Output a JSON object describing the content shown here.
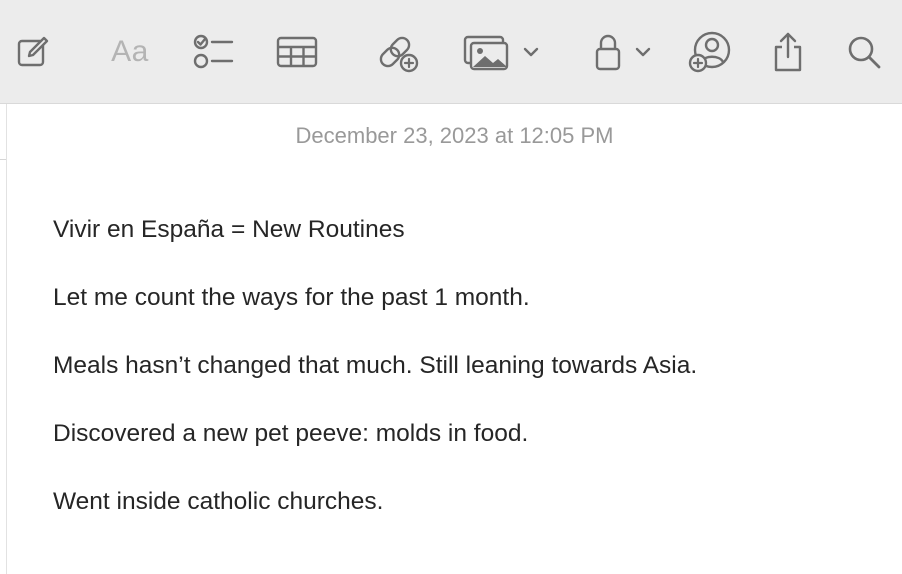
{
  "toolbar": {
    "items": [
      {
        "name": "compose-icon",
        "label": "New Note"
      },
      {
        "name": "format-aa",
        "label": "Aa"
      },
      {
        "name": "checklist-icon",
        "label": "Checklist"
      },
      {
        "name": "table-icon",
        "label": "Table"
      },
      {
        "name": "add-link-icon",
        "label": "Add Link"
      },
      {
        "name": "media-icon",
        "label": "Media"
      },
      {
        "name": "lock-icon",
        "label": "Lock"
      },
      {
        "name": "collaborate-icon",
        "label": "Collaborate"
      },
      {
        "name": "share-icon",
        "label": "Share"
      },
      {
        "name": "search-icon",
        "label": "Search"
      }
    ],
    "format_label": "Aa"
  },
  "note": {
    "timestamp": "December 23, 2023 at 12:05 PM",
    "lines": [
      "Vivir en España = New Routines",
      "Let me count the ways for the past 1 month.",
      "Meals hasn’t changed that much. Still leaning towards Asia.",
      "Discovered a new pet peeve: molds in food.",
      "Went inside catholic churches."
    ]
  },
  "colors": {
    "toolbar_bg": "#ececec",
    "icon": "#6e6e6e",
    "icon_disabled": "#b4b4b4",
    "timestamp": "#999999",
    "text": "#262626"
  }
}
